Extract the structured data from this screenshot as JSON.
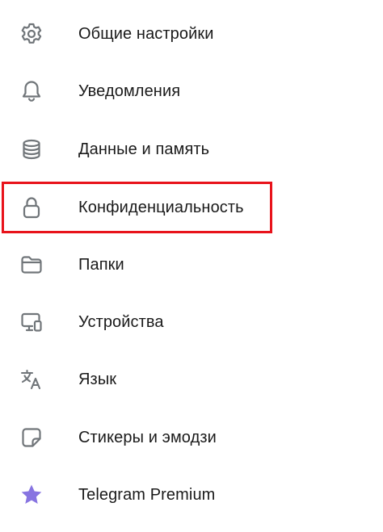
{
  "menu": {
    "items": [
      {
        "label": "Общие настройки",
        "icon": "gear-icon"
      },
      {
        "label": "Уведомления",
        "icon": "bell-icon"
      },
      {
        "label": "Данные и память",
        "icon": "database-icon"
      },
      {
        "label": "Конфиденциальность",
        "icon": "lock-icon"
      },
      {
        "label": "Папки",
        "icon": "folder-icon"
      },
      {
        "label": "Устройства",
        "icon": "devices-icon"
      },
      {
        "label": "Язык",
        "icon": "translate-icon"
      },
      {
        "label": "Стикеры и эмодзи",
        "icon": "sticker-icon"
      },
      {
        "label": "Telegram Premium",
        "icon": "star-icon"
      }
    ]
  },
  "colors": {
    "icon_stroke": "#707579",
    "highlight_border": "#e8131b",
    "premium_star": "#8774e1",
    "text": "#1a1a1a"
  }
}
